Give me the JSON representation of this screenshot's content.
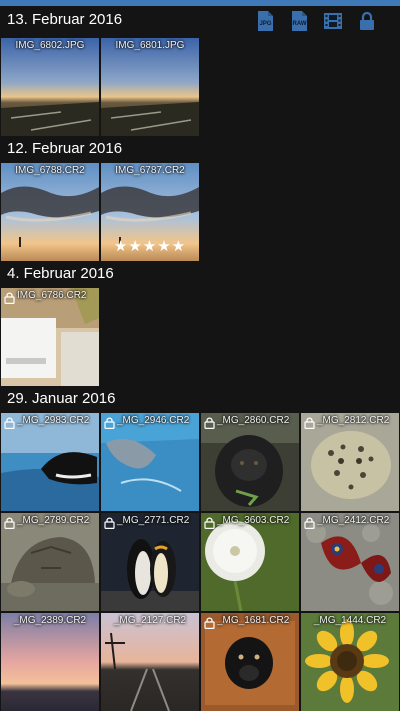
{
  "toolbar": [
    {
      "name": "jpg-filter-icon",
      "label": "JPG"
    },
    {
      "name": "raw-filter-icon",
      "label": "RAW"
    },
    {
      "name": "video-filter-icon",
      "label": ""
    },
    {
      "name": "lock-filter-icon",
      "label": ""
    }
  ],
  "sections": [
    {
      "title": "13. Februar 2016",
      "items": [
        {
          "filename": "IMG_6802.JPG",
          "locked": false,
          "stars": "",
          "thumb": "sunset_field"
        },
        {
          "filename": "IMG_6801.JPG",
          "locked": false,
          "stars": "",
          "thumb": "sunset_field"
        }
      ]
    },
    {
      "title": "12. Februar 2016",
      "items": [
        {
          "filename": "IMG_6788.CR2",
          "locked": false,
          "stars": "",
          "thumb": "sky_clouds"
        },
        {
          "filename": "IMG_6787.CR2",
          "locked": false,
          "stars": "★★★★★",
          "thumb": "sky_clouds"
        }
      ]
    },
    {
      "title": "4. Februar 2016",
      "items": [
        {
          "filename": "IMG_6786.CR2",
          "locked": true,
          "stars": "",
          "thumb": "indoor"
        }
      ]
    },
    {
      "title": "29. Januar 2016",
      "items": [
        {
          "filename": "_MG_2983.CR2",
          "locked": true,
          "stars": "",
          "thumb": "orca"
        },
        {
          "filename": "_MG_2946.CR2",
          "locked": true,
          "stars": "",
          "thumb": "dolphin"
        },
        {
          "filename": "_MG_2860.CR2",
          "locked": true,
          "stars": "",
          "thumb": "gorilla"
        },
        {
          "filename": "_MG_2812.CR2",
          "locked": true,
          "stars": "",
          "thumb": "leopard"
        },
        {
          "filename": "_MG_2789.CR2",
          "locked": true,
          "stars": "",
          "thumb": "tortoise"
        },
        {
          "filename": "_MG_2771.CR2",
          "locked": true,
          "stars": "",
          "thumb": "penguins"
        },
        {
          "filename": "_MG_3603.CR2",
          "locked": true,
          "stars": "",
          "thumb": "dandelion"
        },
        {
          "filename": "_MG_2412.CR2",
          "locked": true,
          "stars": "",
          "thumb": "butterfly"
        },
        {
          "filename": "_MG_2389.CR2",
          "locked": false,
          "stars": "",
          "thumb": "sunset_pink"
        },
        {
          "filename": "_MG_2127.CR2",
          "locked": false,
          "stars": "",
          "thumb": "railway"
        },
        {
          "filename": "_MG_1681.CR2",
          "locked": true,
          "stars": "",
          "thumb": "dog"
        },
        {
          "filename": "_MG_1444.CR2",
          "locked": false,
          "stars": "",
          "thumb": "sunflower"
        }
      ]
    }
  ]
}
